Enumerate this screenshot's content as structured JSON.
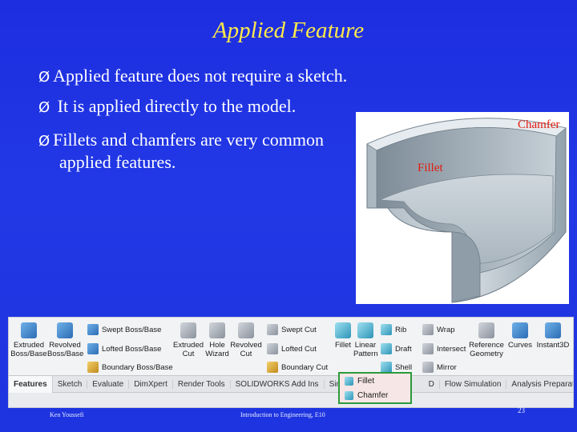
{
  "slide": {
    "title": "Applied Feature",
    "bullets": [
      "Applied feature does not require a sketch.",
      " It is applied directly to the model.",
      "Fillets and chamfers are very common",
      "applied features."
    ],
    "bullet_marker": "Ø",
    "callouts": {
      "chamfer": "Chamfer",
      "fillet": "Fillet"
    },
    "footer": {
      "author": "Ken Youssefi",
      "course": "Introduction to Engineering, E10",
      "page": "23"
    }
  },
  "toolbar": {
    "tools": {
      "extruded_boss": "Extruded Boss/Base",
      "revolved_boss": "Revolved Boss/Base",
      "swept_boss": "Swept Boss/Base",
      "lofted_boss": "Lofted Boss/Base",
      "boundary_boss": "Boundary Boss/Base",
      "extruded_cut": "Extruded Cut",
      "hole_wizard": "Hole Wizard",
      "revolved_cut": "Revolved Cut",
      "swept_cut": "Swept Cut",
      "lofted_cut": "Lofted Cut",
      "boundary_cut": "Boundary Cut",
      "fillet": "Fillet",
      "linear_pattern": "Linear Pattern",
      "rib": "Rib",
      "draft": "Draft",
      "shell": "Shell",
      "wrap": "Wrap",
      "intersect": "Intersect",
      "mirror": "Mirror",
      "reference_geometry": "Reference Geometry",
      "curves": "Curves",
      "instant3d": "Instant3D"
    },
    "tabs": [
      "Features",
      "Sketch",
      "Evaluate",
      "DimXpert",
      "Render Tools",
      "SOLIDWORKS Add Ins",
      "Simul",
      "D",
      "Flow Simulation",
      "Analysis Preparation"
    ],
    "dropdown": {
      "items": [
        "Fillet",
        "Chamfer"
      ]
    },
    "colors": {
      "highlight_border": "#2c9a3a",
      "dropdown_bg": "#f6e6e6"
    }
  }
}
